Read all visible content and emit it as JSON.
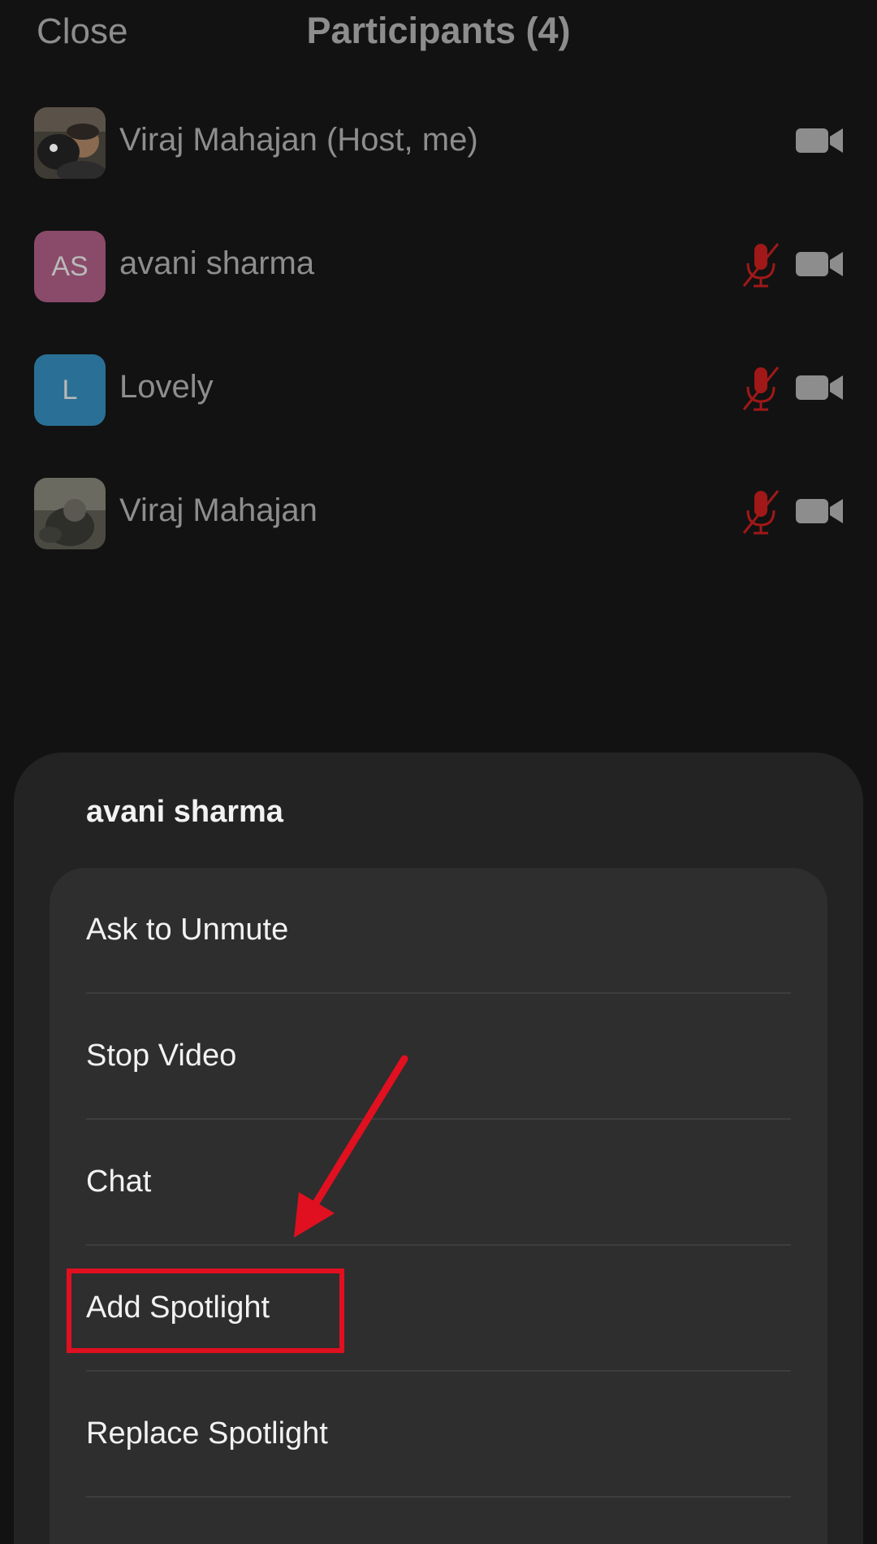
{
  "header": {
    "close_label": "Close",
    "title": "Participants (4)"
  },
  "participants": [
    {
      "name": "Viraj Mahajan (Host, me)",
      "avatar_type": "photo",
      "avatar_initials": "",
      "muted": false,
      "video_icon": "camera-icon"
    },
    {
      "name": "avani sharma",
      "avatar_type": "initials",
      "avatar_initials": "AS",
      "avatar_color": "#b0477f",
      "muted": true,
      "video_icon": "camera-icon"
    },
    {
      "name": "Lovely",
      "avatar_type": "initials",
      "avatar_initials": "L",
      "avatar_color": "#2a7fb0",
      "muted": true,
      "video_icon": "camera-icon"
    },
    {
      "name": "Viraj Mahajan",
      "avatar_type": "photo",
      "avatar_initials": "",
      "muted": true,
      "video_icon": "camera-icon"
    }
  ],
  "action_sheet": {
    "title": "avani sharma",
    "options": [
      {
        "label": "Ask to Unmute"
      },
      {
        "label": "Stop Video"
      },
      {
        "label": "Chat"
      },
      {
        "label": "Add Spotlight",
        "highlighted": true
      },
      {
        "label": "Replace Spotlight"
      }
    ]
  },
  "colors": {
    "background": "#121212",
    "muted_mic": "#a01818",
    "annotation": "#e01020",
    "sheet": "#232323",
    "card": "#2e2e2e"
  }
}
